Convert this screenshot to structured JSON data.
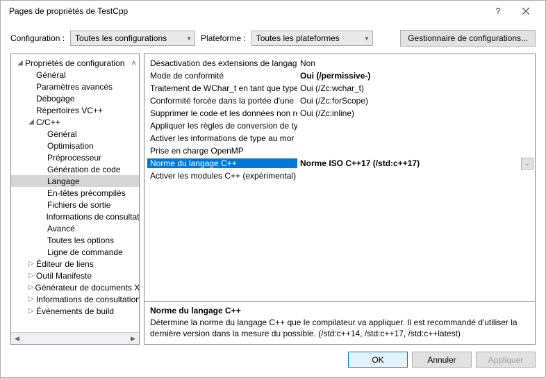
{
  "window": {
    "title": "Pages de propriétés de TestCpp",
    "help": "?",
    "close": "✕"
  },
  "toolbar": {
    "config_label": "Configuration :",
    "config_value": "Toutes les configurations",
    "platform_label": "Plateforme :",
    "platform_value": "Toutes les plateformes",
    "manager_label": "Gestionnaire de configurations..."
  },
  "tree": [
    {
      "indent": 0,
      "tw": "◢",
      "label": "Propriétés de configuration",
      "caret": true
    },
    {
      "indent": 1,
      "tw": "",
      "label": "Général"
    },
    {
      "indent": 1,
      "tw": "",
      "label": "Paramètres avancés"
    },
    {
      "indent": 1,
      "tw": "",
      "label": "Débogage"
    },
    {
      "indent": 1,
      "tw": "",
      "label": "Répertoires VC++"
    },
    {
      "indent": 1,
      "tw": "◢",
      "label": "C/C++"
    },
    {
      "indent": 2,
      "tw": "",
      "label": "Général"
    },
    {
      "indent": 2,
      "tw": "",
      "label": "Optimisation"
    },
    {
      "indent": 2,
      "tw": "",
      "label": "Préprocesseur"
    },
    {
      "indent": 2,
      "tw": "",
      "label": "Génération de code"
    },
    {
      "indent": 2,
      "tw": "",
      "label": "Langage",
      "selected": true
    },
    {
      "indent": 2,
      "tw": "",
      "label": "En-têtes précompilés"
    },
    {
      "indent": 2,
      "tw": "",
      "label": "Fichiers de sortie"
    },
    {
      "indent": 2,
      "tw": "",
      "label": "Informations de consultation"
    },
    {
      "indent": 2,
      "tw": "",
      "label": "Avancé"
    },
    {
      "indent": 2,
      "tw": "",
      "label": "Toutes les options"
    },
    {
      "indent": 2,
      "tw": "",
      "label": "Ligne de commande"
    },
    {
      "indent": 1,
      "tw": "▷",
      "label": "Éditeur de liens"
    },
    {
      "indent": 1,
      "tw": "▷",
      "label": "Outil Manifeste"
    },
    {
      "indent": 1,
      "tw": "▷",
      "label": "Générateur de documents XML"
    },
    {
      "indent": 1,
      "tw": "▷",
      "label": "Informations de consultation"
    },
    {
      "indent": 1,
      "tw": "▷",
      "label": "Événements de build"
    }
  ],
  "props": [
    {
      "name": "Désactivation des extensions de langage",
      "value": "Non"
    },
    {
      "name": "Mode de conformité",
      "value": "Oui (/permissive-)",
      "bold": true
    },
    {
      "name": "Traitement de WChar_t en tant que type",
      "value": "Oui (/Zc:wchar_t)"
    },
    {
      "name": "Conformité forcée dans la portée d'une",
      "value": "Oui (/Zc:forScope)"
    },
    {
      "name": "Supprimer le code et les données non ré",
      "value": "Oui (/Zc:inline)"
    },
    {
      "name": "Appliquer les règles de conversion de ty",
      "value": ""
    },
    {
      "name": "Activer les informations de type au mor",
      "value": ""
    },
    {
      "name": "Prise en charge OpenMP",
      "value": ""
    },
    {
      "name": "Norme du langage C++",
      "value": "Norme ISO C++17 (/std:c++17)",
      "selected": true,
      "bold": true,
      "dd": true
    },
    {
      "name": "Activer les modules C++ (expérimental)",
      "value": ""
    }
  ],
  "desc": {
    "title": "Norme du langage C++",
    "text": "Détermine la norme du langage C++ que le compilateur va appliquer. Il est recommandé d'utiliser la dernière version dans la mesure du possible. (/std:c++14, /std:c++17, /std:c++latest)"
  },
  "footer": {
    "ok": "OK",
    "cancel": "Annuler",
    "apply": "Appliquer"
  }
}
